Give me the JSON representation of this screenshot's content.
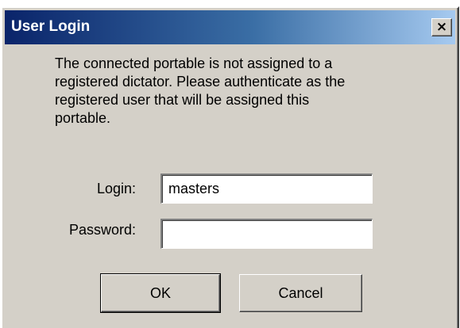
{
  "window": {
    "title": "User Login",
    "close_glyph": "×",
    "close_icon": "close-icon"
  },
  "message": "The connected portable is not assigned to a\nregistered dictator.  Please authenticate as the\nregistered user that will be assigned this\nportable.",
  "form": {
    "login_label": "Login:",
    "login_value": "masters",
    "password_label": "Password:",
    "password_value": ""
  },
  "buttons": {
    "ok_label": "OK",
    "cancel_label": "Cancel"
  },
  "colors": {
    "titlebar_start": "#0a246a",
    "titlebar_end": "#a6caf0",
    "face": "#d4d0c8"
  }
}
